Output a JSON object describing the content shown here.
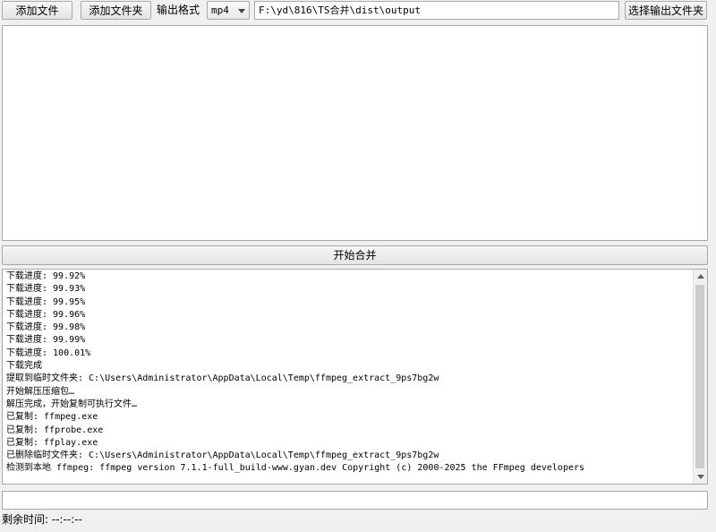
{
  "toolbar": {
    "add_file_label": "添加文件",
    "add_folder_label": "添加文件夹",
    "output_format_label": "输出格式",
    "output_format_value": "mp4",
    "output_path": "F:\\yd\\816\\TS合并\\dist\\output",
    "choose_output_folder_label": "选择输出文件夹"
  },
  "actions": {
    "start_merge_label": "开始合并"
  },
  "log": {
    "lines": [
      "下载进度: 99.92%",
      "下载进度: 99.93%",
      "下载进度: 99.95%",
      "下载进度: 99.96%",
      "下载进度: 99.98%",
      "下载进度: 99.99%",
      "下载进度: 100.01%",
      "下载完成",
      "提取到临时文件夹: C:\\Users\\Administrator\\AppData\\Local\\Temp\\ffmpeg_extract_9ps7bg2w",
      "开始解压压缩包…",
      "解压完成，开始复制可执行文件…",
      "已复制: ffmpeg.exe",
      "已复制: ffprobe.exe",
      "已复制: ffplay.exe",
      "已删除临时文件夹: C:\\Users\\Administrator\\AppData\\Local\\Temp\\ffmpeg_extract_9ps7bg2w",
      "检测到本地 ffmpeg: ffmpeg version 7.1.1-full_build-www.gyan.dev Copyright (c) 2000-2025 the FFmpeg developers"
    ]
  },
  "bottom_input": {
    "value": ""
  },
  "status": {
    "remaining_time_label": "剩余时间: --:--:--"
  },
  "icons": {
    "dropdown": "chevron-down-icon",
    "scroll_up": "arrow-up-icon",
    "scroll_down": "arrow-down-icon"
  }
}
